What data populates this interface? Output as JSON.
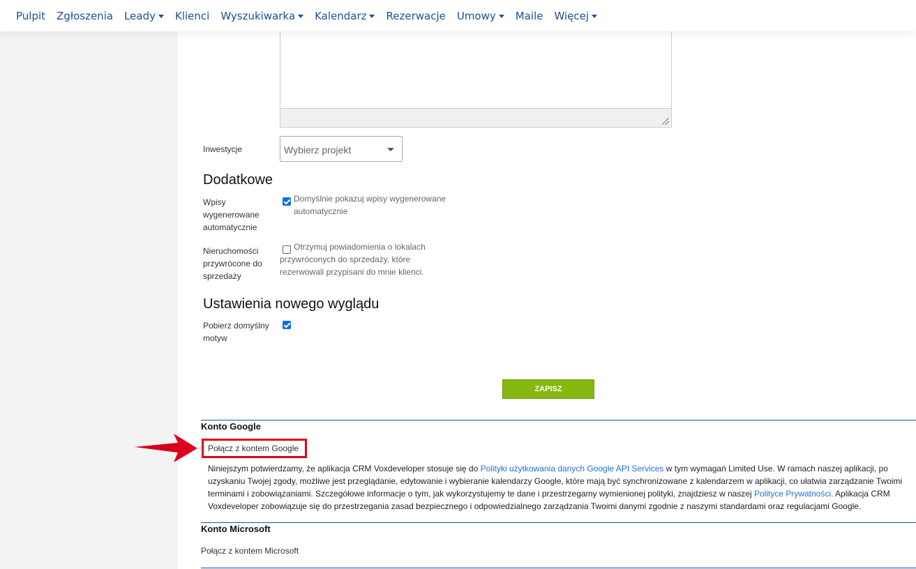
{
  "nav": {
    "items": [
      {
        "label": "Pulpit",
        "dropdown": false
      },
      {
        "label": "Zgłoszenia",
        "dropdown": false
      },
      {
        "label": "Leady",
        "dropdown": true
      },
      {
        "label": "Klienci",
        "dropdown": false
      },
      {
        "label": "Wyszukiwarka",
        "dropdown": true
      },
      {
        "label": "Kalendarz",
        "dropdown": true
      },
      {
        "label": "Rezerwacje",
        "dropdown": false
      },
      {
        "label": "Umowy",
        "dropdown": true
      },
      {
        "label": "Maile",
        "dropdown": false
      },
      {
        "label": "Więcej",
        "dropdown": true
      }
    ]
  },
  "form": {
    "investments_label": "Inwestycje",
    "investments_placeholder": "Wybierz projekt",
    "additional_title": "Dodatkowe",
    "auto_entries_label": "Wpisy wygenerowane automatycznie",
    "auto_entries_checkbox_text": "Domyślnie pokazuj wpisy wygenerowane automatycznie",
    "auto_entries_checked": true,
    "returned_label": "Nieruchomości przywrócone do sprzedaży",
    "returned_checkbox_text": "Otrzymuj powiadomienia o lokalach przywróconych do sprzedaży, które rezerwowali przypisani do mnie klienci.",
    "returned_checked": false,
    "new_look_title": "Ustawienia nowego wyglądu",
    "theme_label": "Pobierz domyślny motyw",
    "theme_checked": true,
    "save_label": "ZAPISZ"
  },
  "google": {
    "title": "Konto Google",
    "connect_label": "Połącz z kontem Google",
    "para_1": "Niniejszym potwierdzamy, że aplikacja CRM Voxdeveloper stosuje się do ",
    "link_policy": "Polityki użytkowania danych Google API Services",
    "para_2": " w tym wymagań Limited Use. W ramach naszej aplikacji, po uzyskaniu Twojej zgody, możliwe jest przeglądanie, edytowanie i wybieranie kalendarzy Google, które mają być synchronizowane z kalendarzem w aplikacji, co ułatwia zarządzanie Twoimi terminami i zobowiązaniami. Szczegółowe informacje o tym, jak wykorzystujemy te dane i przestrzegamy wymienionej polityki, znajdziesz w naszej ",
    "link_privacy": "Polityce Prywatności.",
    "para_3": " Aplikacja CRM Voxdeveloper zobowiązuje się do przestrzegania zasad bezpiecznego i odpowiedzialnego zarządzania Twoimi danymi zgodnie z naszymi standardami oraz regulacjami Google."
  },
  "microsoft": {
    "title": "Konto Microsoft",
    "connect_label": "Połącz z kontem Microsoft"
  },
  "colors": {
    "nav_link": "#1f4e9a",
    "save_button": "#85b90f",
    "highlight": "#e0001b",
    "checkbox": "#0b6fe0"
  }
}
